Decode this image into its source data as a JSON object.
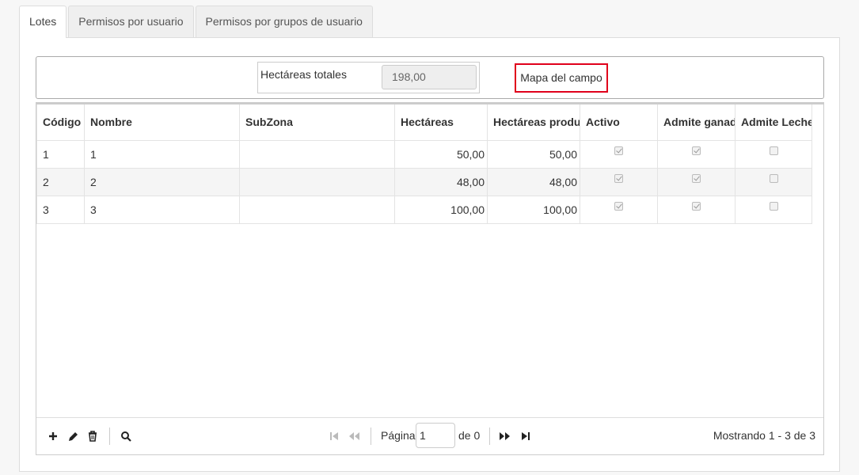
{
  "tabs": [
    {
      "label": "Lotes"
    },
    {
      "label": "Permisos por usuario"
    },
    {
      "label": "Permisos por grupos de usuario"
    }
  ],
  "header": {
    "hectareas_label": "Hectáreas totales",
    "hectareas_value": "198,00",
    "map_button": "Mapa del campo"
  },
  "grid": {
    "columns": [
      "Código",
      "Nombre",
      "SubZona",
      "Hectáreas",
      "Hectáreas productivas",
      "Activo",
      "Admite ganado",
      "Admite Leche"
    ],
    "rows": [
      {
        "codigo": "1",
        "nombre": "1",
        "subzona": "",
        "hectareas": "50,00",
        "productivas": "50,00",
        "activo": true,
        "ganado": true,
        "leche": false
      },
      {
        "codigo": "2",
        "nombre": "2",
        "subzona": "",
        "hectareas": "48,00",
        "productivas": "48,00",
        "activo": true,
        "ganado": true,
        "leche": false
      },
      {
        "codigo": "3",
        "nombre": "3",
        "subzona": "",
        "hectareas": "100,00",
        "productivas": "100,00",
        "activo": true,
        "ganado": true,
        "leche": false
      }
    ]
  },
  "pager": {
    "page_label": "Página",
    "page_value": "1",
    "of_label": "de 0",
    "info": "Mostrando 1 - 3 de 3"
  },
  "icons": [
    "add-icon",
    "edit-icon",
    "delete-icon",
    "search-icon",
    "first-page-icon",
    "prev-page-icon",
    "next-page-icon",
    "last-page-icon"
  ],
  "colors": {
    "highlight": "#e0001b"
  }
}
